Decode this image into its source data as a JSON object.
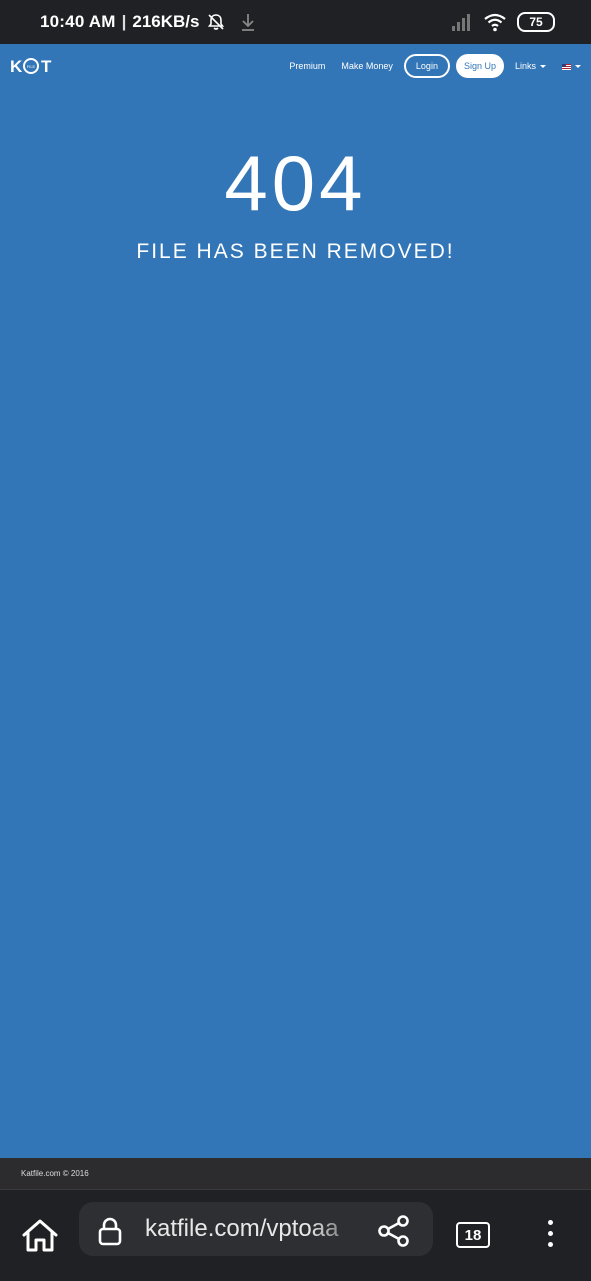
{
  "status_bar": {
    "time": "10:40 AM",
    "separator": "|",
    "net_speed": "216KB/s",
    "battery_level": "75",
    "icons": [
      "muted-bell-icon",
      "download-icon",
      "signal-icon",
      "wifi-icon",
      "battery-icon"
    ]
  },
  "nav": {
    "logo": "KAT FILE",
    "links": {
      "premium": "Premium",
      "make_money": "Make Money",
      "login": "Login",
      "signup": "Sign Up",
      "links": "Links"
    },
    "language_icon": "us-flag-icon"
  },
  "error": {
    "code": "404",
    "message": "FILE HAS BEEN REMOVED!"
  },
  "footer": {
    "copyright": "Katfile.com © 2016"
  },
  "browser_bar": {
    "url": "katfile.com/vptoaa",
    "tab_count": "18",
    "icons": [
      "home-icon",
      "lock-icon",
      "share-icon",
      "tabs-icon",
      "more-vert-icon"
    ]
  },
  "colors": {
    "page_bg": "#3276b8",
    "status_bar_bg": "#202124",
    "footer_bg": "#2c2c2e",
    "text": "#ffffff"
  }
}
